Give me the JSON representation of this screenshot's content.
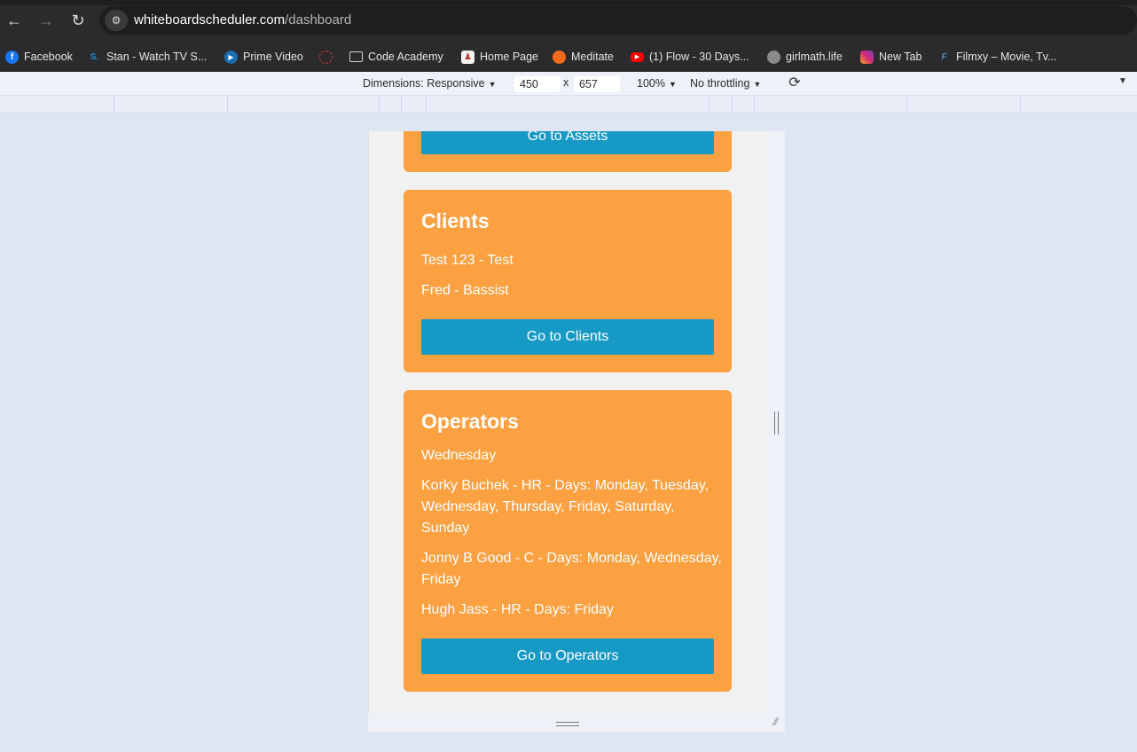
{
  "browser": {
    "url_host": "whiteboardscheduler.com",
    "url_path": "/dashboard",
    "back_icon": "←",
    "forward_icon": "→",
    "reload_icon": "↻",
    "site_info_icon": "⚙"
  },
  "bookmarks": [
    {
      "label": "Facebook",
      "icon": "facebook-icon",
      "glyph": "f",
      "color": "#1877f2"
    },
    {
      "label": "Stan - Watch TV S...",
      "icon": "stan-icon",
      "glyph": "S.",
      "color": "#0b79d0"
    },
    {
      "label": "Prime Video",
      "icon": "prime-video-icon",
      "glyph": "▶",
      "color": "#1a98ff"
    },
    {
      "label": "",
      "icon": "loading-circle-icon",
      "glyph": "◌",
      "color": "#e03a3a"
    },
    {
      "label": "Code Academy",
      "icon": "folder-icon",
      "glyph": "▭",
      "color": "#2b2b2d"
    },
    {
      "label": "Home Page",
      "icon": "home-page-icon",
      "glyph": "♟",
      "color": "#c0392b"
    },
    {
      "label": "Meditate",
      "icon": "meditate-icon",
      "glyph": "●",
      "color": "#f26b1d"
    },
    {
      "label": "(1) Flow - 30 Days...",
      "icon": "youtube-icon",
      "glyph": "▶",
      "color": "#ff0000"
    },
    {
      "label": "girlmath.life",
      "icon": "globe-icon",
      "glyph": "◍",
      "color": "#7a7a7a"
    },
    {
      "label": "New Tab",
      "icon": "instagram-icon",
      "glyph": "◎",
      "color": "#d62976"
    },
    {
      "label": "Filmxy – Movie, Tv...",
      "icon": "filmxy-icon",
      "glyph": "F",
      "color": "#2b2b2d"
    }
  ],
  "devtools": {
    "dimensions_label": "Dimensions: Responsive",
    "width": "450",
    "times": "x",
    "height": "657",
    "zoom": "100%",
    "throttling": "No throttling",
    "caret": "▼",
    "rotate_icon": "⟳"
  },
  "dashboard": {
    "assets_button": "Go to Assets",
    "clients": {
      "title": "Clients",
      "items": [
        "Test 123 - Test",
        "Fred - Bassist"
      ],
      "button": "Go to Clients"
    },
    "operators": {
      "title": "Operators",
      "day": "Wednesday",
      "items": [
        "Korky Buchek - HR - Days: Monday, Tuesday, Wednesday, Thursday, Friday, Saturday, Sunday",
        "Jonny B Good - C - Days: Monday, Wednesday, Friday",
        "Hugh Jass - HR - Days: Friday"
      ],
      "button": "Go to Operators"
    }
  },
  "colors": {
    "card": "#fba142",
    "button": "#1699c4",
    "device_bg": "#f0f2f1",
    "page_bg": "#dee6f3"
  }
}
